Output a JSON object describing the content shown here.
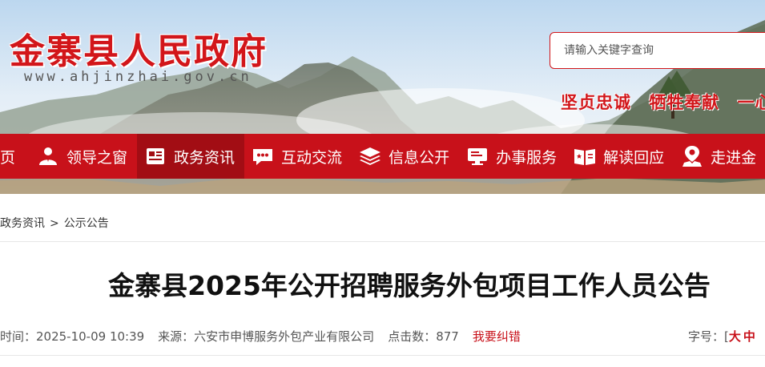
{
  "header": {
    "site_title": "金寨县人民政府",
    "site_url": "www.ahjinzhai.gov.cn",
    "search_placeholder": "请输入关键字查询",
    "slogans": [
      "坚贞忠诚",
      "牺牲奉献",
      "一心"
    ]
  },
  "nav": {
    "items": [
      {
        "label": "页",
        "icon": "home-icon"
      },
      {
        "label": "领导之窗",
        "icon": "leader-icon"
      },
      {
        "label": "政务资讯",
        "icon": "news-icon"
      },
      {
        "label": "互动交流",
        "icon": "chat-icon"
      },
      {
        "label": "信息公开",
        "icon": "layers-icon"
      },
      {
        "label": "办事服务",
        "icon": "monitor-icon"
      },
      {
        "label": "解读回应",
        "icon": "document-icon"
      },
      {
        "label": "走进金",
        "icon": "location-icon"
      }
    ],
    "active_index": 2
  },
  "breadcrumb": {
    "items": [
      "政务资讯",
      "公示公告"
    ],
    "separator": ">"
  },
  "article": {
    "title": "金寨县2025年公开招聘服务外包项目工作人员公告",
    "time": "时间：2025-10-09 10:39",
    "source": "来源：六安市申博服务外包产业有限公司",
    "views": "点击数：877",
    "correction": "我要纠错",
    "font_label": "字号：",
    "font_open": "[",
    "font_large": "大",
    "font_medium": "中"
  },
  "colors": {
    "brand_red": "#c8111a",
    "active_nav": "#a20d14",
    "title_red": "#d2161a"
  }
}
